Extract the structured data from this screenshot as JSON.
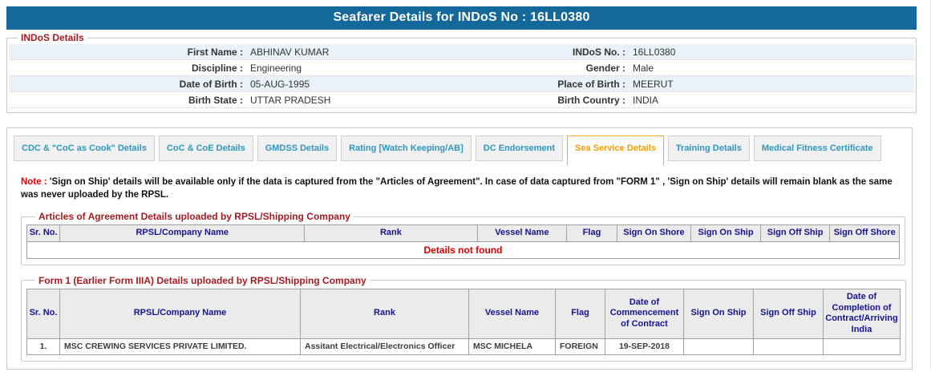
{
  "header": {
    "title": "Seafarer Details for INDoS No : 16LL0380"
  },
  "colors": {
    "title_bar_bg": "#15689A",
    "active_tab_accent": "#F5AC1E",
    "tab_text": "#2E96BD",
    "legend_red": "#A21C21",
    "table_header_text": "#14148C",
    "error_red": "#D40000"
  },
  "indos": {
    "legend": "INDoS Details",
    "rows": [
      {
        "label1": "First Name :",
        "value1": "ABHINAV KUMAR",
        "label2": "INDoS No. :",
        "value2": "16LL0380"
      },
      {
        "label1": "Discipline :",
        "value1": "Engineering",
        "label2": "Gender :",
        "value2": "Male"
      },
      {
        "label1": "Date of Birth :",
        "value1": "05-AUG-1995",
        "label2": "Place of Birth :",
        "value2": "MEERUT"
      },
      {
        "label1": "Birth State :",
        "value1": "UTTAR PRADESH",
        "label2": "Birth Country :",
        "value2": "INDIA"
      }
    ]
  },
  "tabs": [
    {
      "label": "CDC & \"CoC as Cook\" Details",
      "active": false
    },
    {
      "label": "CoC & CoE Details",
      "active": false
    },
    {
      "label": "GMDSS Details",
      "active": false
    },
    {
      "label": "Rating [Watch Keeping/AB]",
      "active": false
    },
    {
      "label": "DC Endorsement",
      "active": false
    },
    {
      "label": "Sea Service Details",
      "active": true
    },
    {
      "label": "Training Details",
      "active": false
    },
    {
      "label": "Medical Fitness Certificate",
      "active": false
    }
  ],
  "note": {
    "label": "Note :",
    "text": "'Sign on Ship' details will be available only if the data is captured from the \"Articles of Agreement\". In case of data captured from \"FORM 1\" , 'Sign on Ship' details will remain blank as the same was never uploaded by the RPSL."
  },
  "articles": {
    "legend": "Articles of Agreement Details uploaded by RPSL/Shipping Company",
    "headers": [
      "Sr. No.",
      "RPSL/Company Name",
      "Rank",
      "Vessel Name",
      "Flag",
      "Sign On Shore",
      "Sign On Ship",
      "Sign Off Ship",
      "Sign Off Shore"
    ],
    "empty_message": "Details not found"
  },
  "form1": {
    "legend": "Form 1 (Earlier Form IIIA) Details uploaded by RPSL/Shipping Company",
    "headers": [
      "Sr. No.",
      "RPSL/Company Name",
      "Rank",
      "Vessel Name",
      "Flag",
      "Date of Commencement of Contract",
      "Sign On Ship",
      "Sign Off Ship",
      "Date of Completion of Contract/Arriving India"
    ],
    "rows": [
      {
        "sr": "1.",
        "company": "MSC CREWING SERVICES PRIVATE LIMITED.",
        "rank": "Assitant Electrical/Electronics Officer",
        "vessel": "MSC MICHELA",
        "flag": "FOREIGN",
        "commencement": "19-SEP-2018",
        "sign_on_ship": "",
        "sign_off_ship": "",
        "completion": ""
      }
    ]
  }
}
